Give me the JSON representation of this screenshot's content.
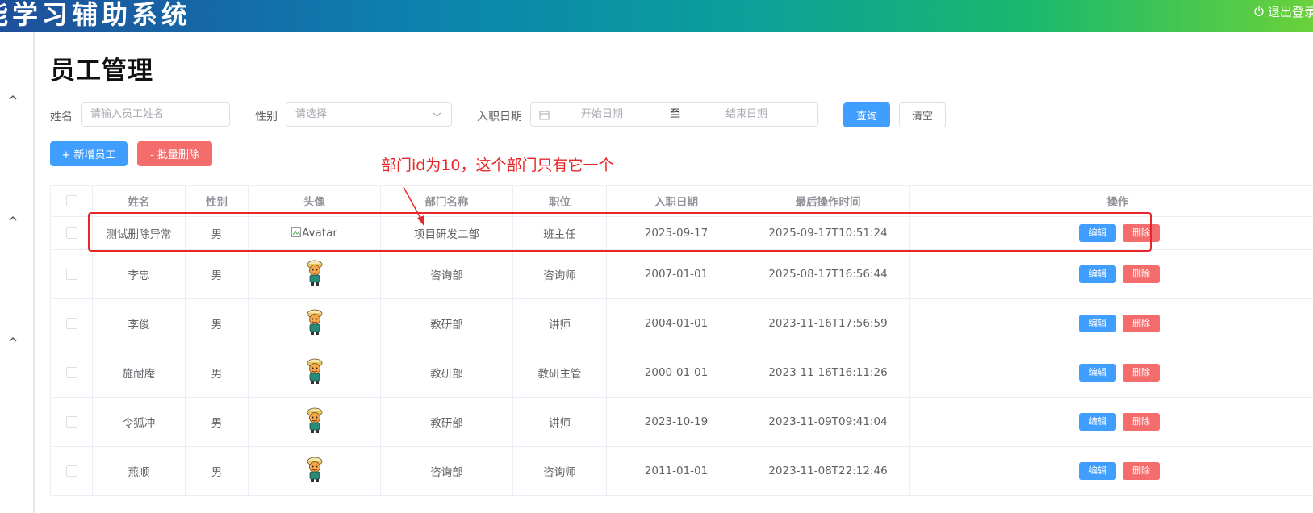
{
  "header": {
    "app_title": "能学习辅助系统",
    "logout_label": "退出登录"
  },
  "page": {
    "title": "员工管理"
  },
  "search": {
    "name_label": "姓名",
    "name_placeholder": "请输入员工姓名",
    "gender_label": "性别",
    "gender_placeholder": "请选择",
    "entry_label": "入职日期",
    "start_placeholder": "开始日期",
    "range_separator": "至",
    "end_placeholder": "结束日期",
    "query_label": "查询",
    "clear_label": "清空"
  },
  "actions": {
    "add_label": "+ 新增员工",
    "batch_delete_label": "- 批量删除"
  },
  "annotation": {
    "text": "部门id为10，这个部门只有它一个"
  },
  "table": {
    "columns": [
      "姓名",
      "性别",
      "头像",
      "部门名称",
      "职位",
      "入职日期",
      "最后操作时间",
      "操作"
    ],
    "edit_label": "编辑",
    "delete_label": "删除",
    "rows": [
      {
        "name": "测试删除异常",
        "gender": "男",
        "avatar_alt": "Avatar",
        "dept": "项目研发二部",
        "job": "班主任",
        "entry_date": "2025-09-17",
        "update_time": "2025-09-17T10:51:24"
      },
      {
        "name": "李忠",
        "gender": "男",
        "dept": "咨询部",
        "job": "咨询师",
        "entry_date": "2007-01-01",
        "update_time": "2025-08-17T16:56:44"
      },
      {
        "name": "李俊",
        "gender": "男",
        "dept": "教研部",
        "job": "讲师",
        "entry_date": "2004-01-01",
        "update_time": "2023-11-16T17:56:59"
      },
      {
        "name": "施耐庵",
        "gender": "男",
        "dept": "教研部",
        "job": "教研主管",
        "entry_date": "2000-01-01",
        "update_time": "2023-11-16T16:11:26"
      },
      {
        "name": "令狐冲",
        "gender": "男",
        "dept": "教研部",
        "job": "讲师",
        "entry_date": "2023-10-19",
        "update_time": "2023-11-09T09:41:04"
      },
      {
        "name": "燕顺",
        "gender": "男",
        "dept": "咨询部",
        "job": "咨询师",
        "entry_date": "2011-01-01",
        "update_time": "2023-11-08T22:12:46"
      }
    ]
  },
  "colors": {
    "primary": "#409eff",
    "danger": "#f56c6c",
    "annotation": "#e8262a"
  }
}
